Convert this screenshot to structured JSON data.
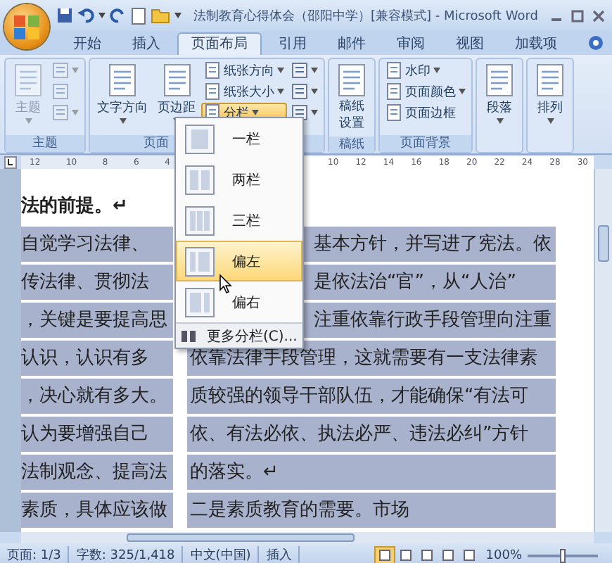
{
  "window": {
    "title": "法制教育心得体会（邵阳中学）[兼容模式] - Microsoft Word"
  },
  "tabs": [
    {
      "label": "开始",
      "selected": false
    },
    {
      "label": "插入",
      "selected": false
    },
    {
      "label": "页面布局",
      "selected": true
    },
    {
      "label": "引用",
      "selected": false
    },
    {
      "label": "邮件",
      "selected": false
    },
    {
      "label": "审阅",
      "selected": false
    },
    {
      "label": "视图",
      "selected": false
    },
    {
      "label": "加载项",
      "selected": false
    }
  ],
  "ribbon": {
    "groups": [
      {
        "label": "主题",
        "columns": [
          [
            {
              "kind": "large",
              "label": "主题",
              "dropdown": true,
              "disabled": true,
              "selected": false
            }
          ],
          [
            {
              "kind": "icon",
              "dropdown": true,
              "disabled": true,
              "selected": false
            },
            {
              "kind": "icon",
              "dropdown": false,
              "disabled": true,
              "selected": false
            },
            {
              "kind": "icon",
              "dropdown": true,
              "disabled": true,
              "selected": false
            }
          ]
        ]
      },
      {
        "label": "页面",
        "columns": [
          [
            {
              "kind": "large",
              "label": "文字方向",
              "dropdown": true,
              "disabled": false,
              "selected": false
            }
          ],
          [
            {
              "kind": "large",
              "label": "页边距",
              "dropdown": true,
              "disabled": false,
              "selected": false
            }
          ],
          [
            {
              "kind": "small",
              "label": "纸张方向",
              "dropdown": true,
              "disabled": false,
              "selected": false
            },
            {
              "kind": "small",
              "label": "纸张大小",
              "dropdown": true,
              "disabled": false,
              "selected": false
            },
            {
              "kind": "small",
              "label": "分栏",
              "dropdown": true,
              "disabled": false,
              "selected": true
            }
          ],
          [
            {
              "kind": "icon",
              "dropdown": true,
              "disabled": false,
              "selected": false
            },
            {
              "kind": "icon",
              "dropdown": true,
              "disabled": false,
              "selected": false
            },
            {
              "kind": "icon",
              "dropdown": true,
              "disabled": false,
              "selected": false
            }
          ]
        ]
      },
      {
        "label": "稿纸",
        "columns": [
          [
            {
              "kind": "large",
              "label": "稿纸设置",
              "dropdown": false,
              "disabled": false,
              "selected": false
            }
          ]
        ]
      },
      {
        "label": "页面背景",
        "columns": [
          [
            {
              "kind": "small",
              "label": "水印",
              "dropdown": true,
              "disabled": false,
              "selected": false
            },
            {
              "kind": "small",
              "label": "页面颜色",
              "dropdown": true,
              "disabled": false,
              "selected": false
            },
            {
              "kind": "small",
              "label": "页面边框",
              "dropdown": false,
              "disabled": false,
              "selected": false
            }
          ]
        ]
      },
      {
        "columns": [
          [
            {
              "kind": "large",
              "label": "段落",
              "dropdown": true,
              "disabled": false,
              "selected": false
            }
          ]
        ]
      },
      {
        "columns": [
          [
            {
              "kind": "large",
              "label": "排列",
              "dropdown": true,
              "disabled": false,
              "selected": false
            }
          ]
        ]
      }
    ]
  },
  "ruler": {
    "left_ticks": [
      "12",
      "10",
      "8",
      "6",
      "4"
    ],
    "right_ticks": [
      "10",
      "12",
      "14",
      "16",
      "18",
      "20",
      "22",
      "24",
      "28",
      "30"
    ]
  },
  "menu": {
    "items": [
      {
        "kind": "one",
        "label": "一栏",
        "selected": false
      },
      {
        "kind": "two",
        "label": "两栏",
        "selected": false
      },
      {
        "kind": "three",
        "label": "三栏",
        "selected": false
      },
      {
        "kind": "left",
        "label": "偏左",
        "selected": true
      },
      {
        "kind": "right",
        "label": "偏右",
        "selected": false
      }
    ],
    "more": "更多分栏(C)..."
  },
  "document": {
    "lines": [
      {
        "kind": "heading",
        "left": "法的前提。↵",
        "selected": false
      },
      {
        "kind": "body",
        "left": "自觉学习法律、",
        "right": "基本方针，并写进了宪法。依",
        "selected": true
      },
      {
        "kind": "body",
        "left": "传法律、贯彻法",
        "right": "是依法治“官”，从“人治”",
        "selected": true
      },
      {
        "kind": "body",
        "left": "，关键是要提高思",
        "right": "注重依靠行政手段管理向注重",
        "selected": true
      },
      {
        "kind": "body",
        "left": "认识，认识有多",
        "right": "依靠法律手段管理，这就需要有一支法律素",
        "selected": true
      },
      {
        "kind": "body",
        "left": "，决心就有多大。",
        "right": "质较强的领导干部队伍，才能确保“有法可",
        "selected": true
      },
      {
        "kind": "body",
        "left": "认为要增强自己",
        "right": "依、有法必依、执法必严、违法必纠”方针",
        "selected": true
      },
      {
        "kind": "body",
        "left": "法制观念、提高法",
        "right": "的落实。↵",
        "selected": true
      },
      {
        "kind": "body",
        "left": "素质，具体应该做",
        "right": "二是素质教育的需要。市场",
        "selected": true
      }
    ]
  },
  "status_bar": {
    "page": "页面: 1/3",
    "words": "字数: 325/1,418",
    "language": "中文(中国)",
    "mode": "插入",
    "views": [
      {
        "selected": true
      },
      {
        "selected": false
      },
      {
        "selected": false
      },
      {
        "selected": false
      },
      {
        "selected": false
      }
    ],
    "zoom": "100%",
    "zoom_slider": {
      "level": 0.5
    }
  }
}
